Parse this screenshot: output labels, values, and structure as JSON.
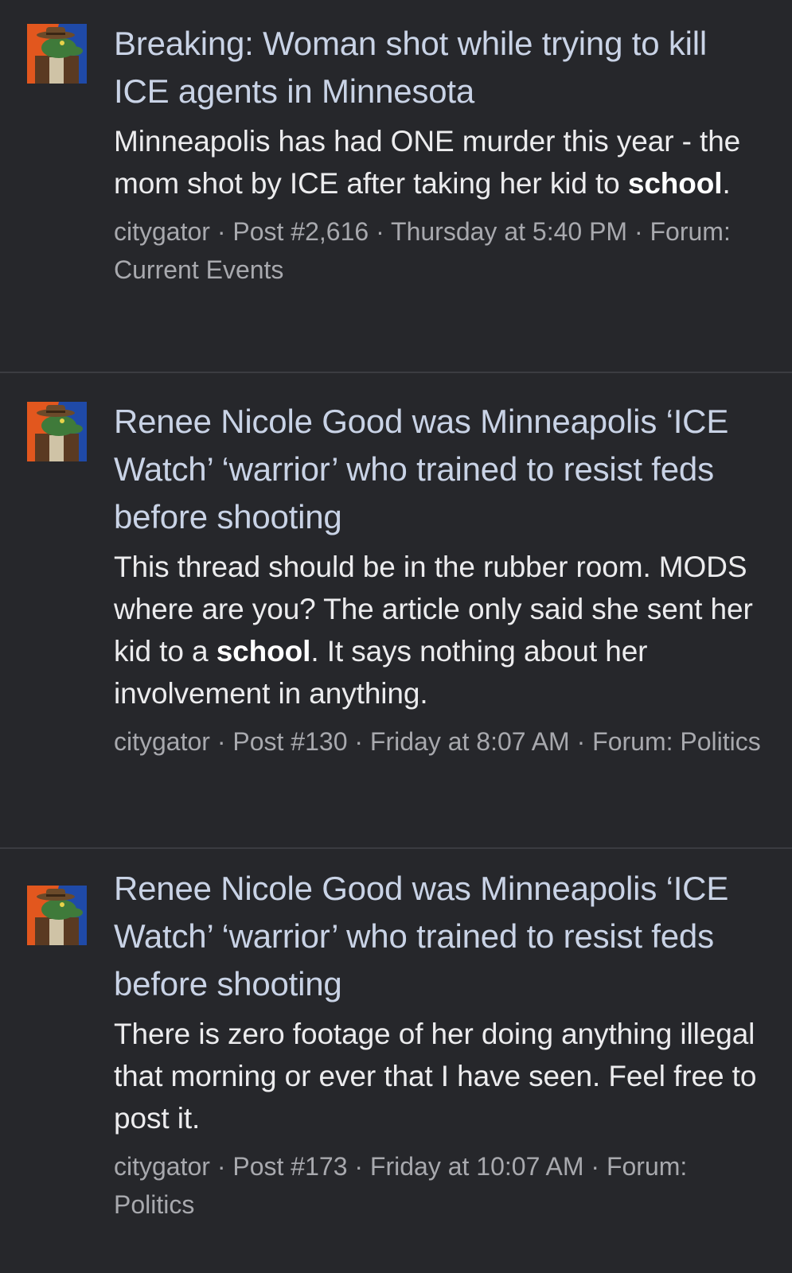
{
  "results": [
    {
      "title": "Breaking: Woman shot while trying to kill ICE agents in Minnesota",
      "snippet_before": "Minneapolis has had ONE murder this year - the mom shot by ICE after taking her kid to ",
      "snippet_highlight": "school",
      "snippet_after": ".",
      "author": "citygator",
      "post": "Post #2,616",
      "time": "Thursday at 5:40 PM",
      "forum_prefix": "Forum:",
      "forum": "Current Events",
      "separator": "·"
    },
    {
      "title": "Renee Nicole Good was Minneapolis ‘ICE Watch’ ‘warrior’ who trained to resist feds before shooting",
      "snippet_before": "This thread should be in the rubber room. MODS where are you? The article only said she sent her kid to a ",
      "snippet_highlight": "school",
      "snippet_after": ". It says nothing about her involvement in anything.",
      "author": "citygator",
      "post": "Post #130",
      "time": "Friday at 8:07 AM",
      "forum_prefix": "Forum:",
      "forum": "Politics",
      "separator": "·"
    },
    {
      "title": "Renee Nicole Good was Minneapolis ‘ICE Watch’ ‘warrior’ who trained to resist feds before shooting",
      "snippet_before": "There is zero footage of her doing anything illegal that morning or ever that I have seen. Feel free to post it.",
      "snippet_highlight": "",
      "snippet_after": "",
      "author": "citygator",
      "post": "Post #173",
      "time": "Friday at 10:07 AM",
      "forum_prefix": "Forum:",
      "forum": "Politics",
      "separator": "·"
    }
  ],
  "colors": {
    "background": "#26272b",
    "title": "#c9d3e6",
    "snippet": "#ececee",
    "meta": "#a8a9ae",
    "divider": "#3b3c41",
    "avatar_orange": "#e2571e",
    "avatar_blue": "#1f4aa8"
  },
  "icons": {
    "avatar": "alligator-fedora-avatar-icon"
  }
}
